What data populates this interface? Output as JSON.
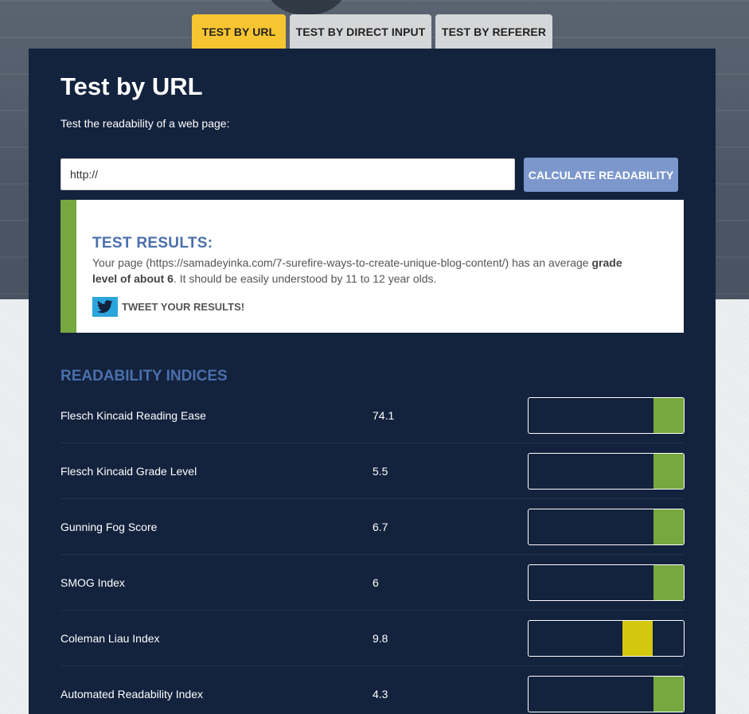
{
  "tabs": [
    {
      "label": "TEST BY URL",
      "active": true
    },
    {
      "label": "TEST BY DIRECT INPUT",
      "active": false
    },
    {
      "label": "TEST BY REFERER",
      "active": false
    }
  ],
  "main": {
    "title": "Test by URL",
    "subtitle": "Test the readability of a web page:",
    "url_input": {
      "value": "http://",
      "placeholder": ""
    },
    "calculate_label": "CALCULATE READABILITY"
  },
  "results": {
    "title": "TEST RESULTS:",
    "text_before": "Your page (https://samadeyinka.com/7-surefire-ways-to-create-unique-blog-content/) has an average ",
    "text_bold": "grade level of about 6",
    "text_after": ". It should be easily understood by 11 to 12 year olds.",
    "tweet_label": "TWEET YOUR RESULTS!",
    "accent_color": "#76a83f"
  },
  "indices": {
    "title": "READABILITY INDICES",
    "rows": [
      {
        "name": "Flesch Kincaid Reading Ease",
        "value": "74.1",
        "status_color": "#76a83f",
        "bar_level": 0.9
      },
      {
        "name": "Flesch Kincaid Grade Level",
        "value": "5.5",
        "status_color": "#76a83f",
        "bar_level": 0.9
      },
      {
        "name": "Gunning Fog Score",
        "value": "6.7",
        "status_color": "#76a83f",
        "bar_level": 0.9
      },
      {
        "name": "SMOG Index",
        "value": "6",
        "status_color": "#76a83f",
        "bar_level": 0.9
      },
      {
        "name": "Coleman Liau Index",
        "value": "9.8",
        "status_color": "#d4c80f",
        "bar_level": 0.7
      },
      {
        "name": "Automated Readability Index",
        "value": "4.3",
        "status_color": "#76a83f",
        "bar_level": 0.9
      }
    ]
  },
  "colors": {
    "panel_bg": "#13223d",
    "active_tab": "#f7c531",
    "inactive_tab": "#d5d6d8",
    "button": "#7b97cc",
    "heading_blue": "#4a6fab",
    "twitter": "#2aa6dd"
  },
  "icons": {
    "tweet": "twitter-bird-icon"
  }
}
